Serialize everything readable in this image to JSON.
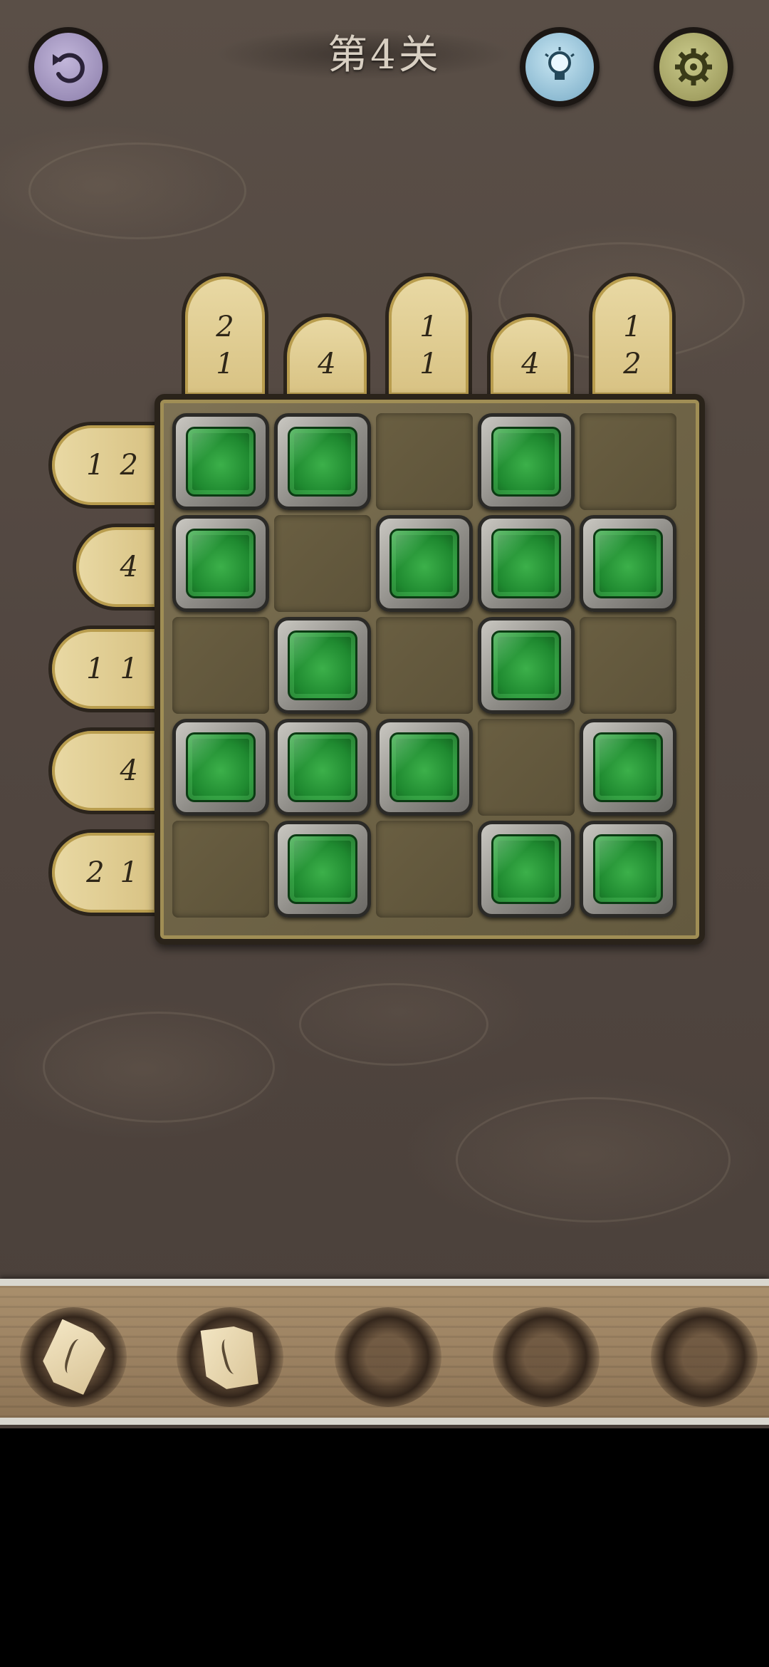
{
  "header": {
    "level_title": "第4关",
    "undo_icon": "undo-icon",
    "hint_icon": "lightbulb-icon",
    "settings_icon": "gear-icon"
  },
  "puzzle": {
    "column_clues": [
      [
        "2",
        "1"
      ],
      [
        "4"
      ],
      [
        "1",
        "1"
      ],
      [
        "4"
      ],
      [
        "1",
        "2"
      ]
    ],
    "row_clues": [
      [
        "1",
        "2"
      ],
      [
        "4"
      ],
      [
        "1",
        "1"
      ],
      [
        "4"
      ],
      [
        "2",
        "1"
      ]
    ],
    "grid": [
      [
        1,
        1,
        0,
        1,
        0
      ],
      [
        1,
        0,
        1,
        1,
        1
      ],
      [
        0,
        1,
        0,
        1,
        0
      ],
      [
        1,
        1,
        1,
        0,
        1
      ],
      [
        0,
        1,
        0,
        1,
        1
      ]
    ]
  },
  "inventory": {
    "slots": [
      {
        "item": "paper-scrap-icon"
      },
      {
        "item": "paper-scrap-icon"
      },
      {
        "item": ""
      },
      {
        "item": ""
      },
      {
        "item": ""
      }
    ]
  },
  "colors": {
    "gem": "#2a9a3a",
    "clue_tab": "#e2d096",
    "board": "#756a4c",
    "background": "#544943"
  }
}
